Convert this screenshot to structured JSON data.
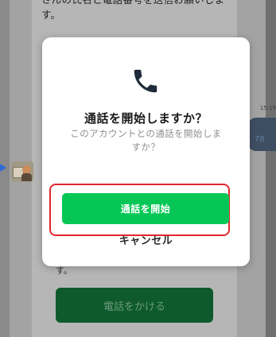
{
  "background": {
    "message_lines": [
      "",
      "さんの氏名と電話番号を送信お願いしま",
      "す。"
    ],
    "bottom_text": "す。",
    "call_button_label": "電話をかける",
    "timestamp": "15:19",
    "bubble_text": "78"
  },
  "dialog": {
    "icon": "phone-icon",
    "title": "通話を開始しますか？",
    "message": "このアカウントとの通話を開始しますか？",
    "start_button_label": "通話を開始",
    "cancel_label": "キャンセル"
  },
  "colors": {
    "accent_green": "#06c755",
    "highlight_red": "#e0262d",
    "icon_color": "#1f2b3a"
  }
}
